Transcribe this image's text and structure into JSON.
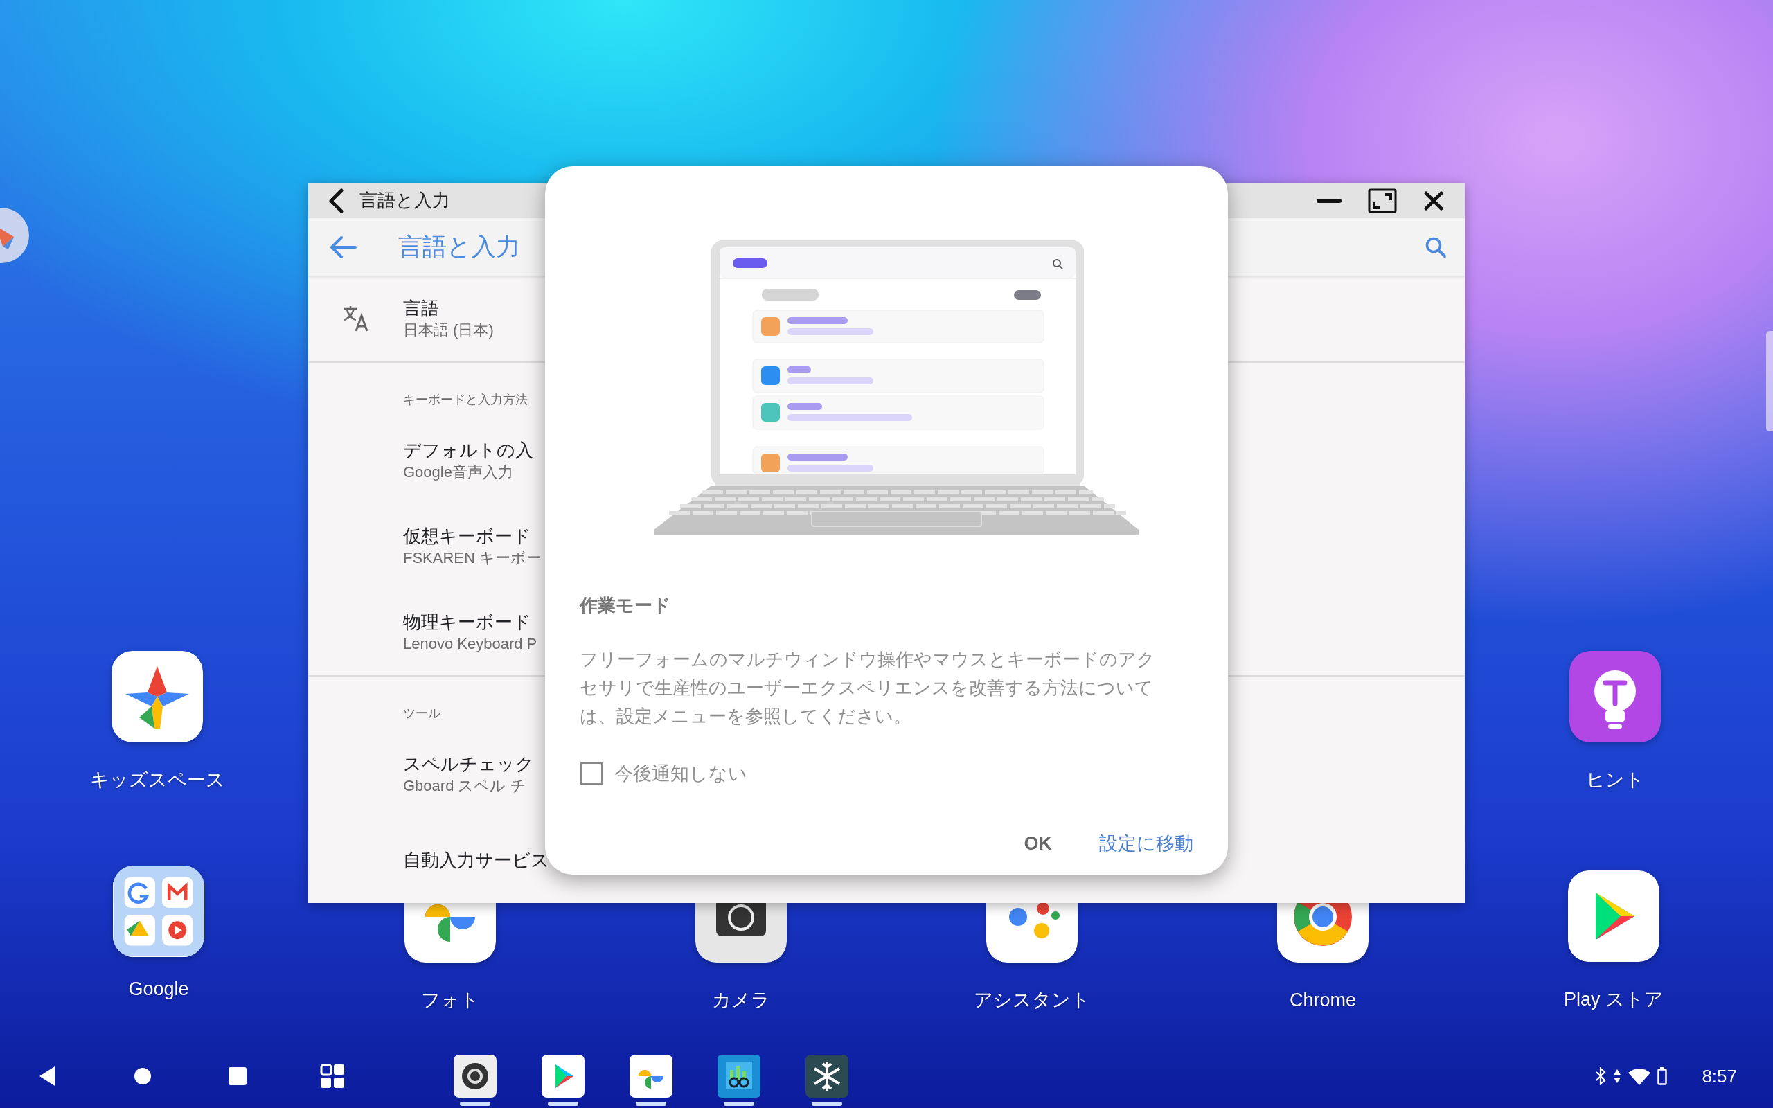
{
  "desktop_icons": [
    {
      "label": "キッズスペース",
      "kind": "kids"
    },
    {
      "label": "ヒント",
      "kind": "hint"
    },
    {
      "label": "Google",
      "kind": "google-folder"
    },
    {
      "label": "フォト",
      "kind": "photos"
    },
    {
      "label": "カメラ",
      "kind": "camera"
    },
    {
      "label": "アシスタント",
      "kind": "assistant"
    },
    {
      "label": "Chrome",
      "kind": "chrome"
    },
    {
      "label": "Play ストア",
      "kind": "play"
    }
  ],
  "window": {
    "title": "言語と入力",
    "app_bar_title": "言語と入力",
    "sections": [
      {
        "items": [
          {
            "title": "言語",
            "subtitle": "日本語 (日本)"
          }
        ]
      },
      {
        "header": "キーボードと入力方法",
        "items": [
          {
            "title": "デフォルトの入",
            "subtitle": "Google音声入力"
          },
          {
            "title": "仮想キーボード",
            "subtitle": "FSKAREN キーボー"
          },
          {
            "title": "物理キーボード",
            "subtitle": "Lenovo Keyboard P"
          }
        ]
      },
      {
        "header": "ツール",
        "items": [
          {
            "title": "スペルチェック",
            "subtitle": "Gboard スペル チ"
          },
          {
            "title": "自動入力サービス"
          }
        ]
      }
    ]
  },
  "dialog": {
    "title": "作業モード",
    "message": "フリーフォームのマルチウィンドウ操作やマウスとキーボードのアクセサリで生産性のユーザーエクスペリエンスを改善する方法については、設定メニューを参照してください。",
    "checkbox": {
      "label": "今後通知しない",
      "checked": false
    },
    "buttons": [
      {
        "label": "OK",
        "kind": "neutral"
      },
      {
        "label": "設定に移動",
        "kind": "primary"
      }
    ]
  },
  "status_bar": {
    "time": "8:57"
  }
}
